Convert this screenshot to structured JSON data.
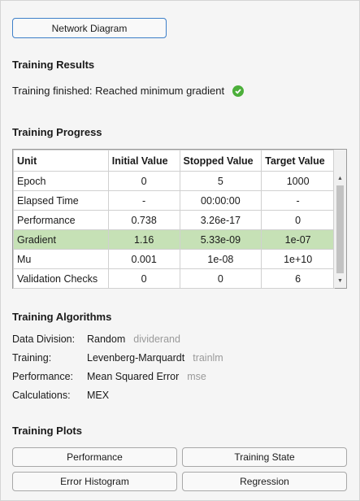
{
  "network_button": "Network Diagram",
  "results": {
    "heading": "Training Results",
    "status_text": "Training finished: Reached minimum gradient",
    "status_icon": "check-circle-icon"
  },
  "progress": {
    "heading": "Training Progress",
    "columns": [
      "Unit",
      "Initial Value",
      "Stopped Value",
      "Target Value"
    ],
    "rows": [
      {
        "unit": "Epoch",
        "initial": "0",
        "stopped": "5",
        "target": "1000"
      },
      {
        "unit": "Elapsed Time",
        "initial": "-",
        "stopped": "00:00:00",
        "target": "-"
      },
      {
        "unit": "Performance",
        "initial": "0.738",
        "stopped": "3.26e-17",
        "target": "0"
      },
      {
        "unit": "Gradient",
        "initial": "1.16",
        "stopped": "5.33e-09",
        "target": "1e-07"
      },
      {
        "unit": "Mu",
        "initial": "0.001",
        "stopped": "1e-08",
        "target": "1e+10"
      },
      {
        "unit": "Validation Checks",
        "initial": "0",
        "stopped": "0",
        "target": "6"
      }
    ],
    "highlight_color": "#c6e1b6"
  },
  "algorithms": {
    "heading": "Training Algorithms",
    "items": [
      {
        "key": "Data Division:",
        "value": "Random",
        "fn": "dividerand"
      },
      {
        "key": "Training:",
        "value": "Levenberg-Marquardt",
        "fn": "trainlm"
      },
      {
        "key": "Performance:",
        "value": "Mean Squared Error",
        "fn": "mse"
      },
      {
        "key": "Calculations:",
        "value": "MEX",
        "fn": ""
      }
    ]
  },
  "plots": {
    "heading": "Training Plots",
    "buttons": [
      "Performance",
      "Training State",
      "Error Histogram",
      "Regression"
    ]
  }
}
